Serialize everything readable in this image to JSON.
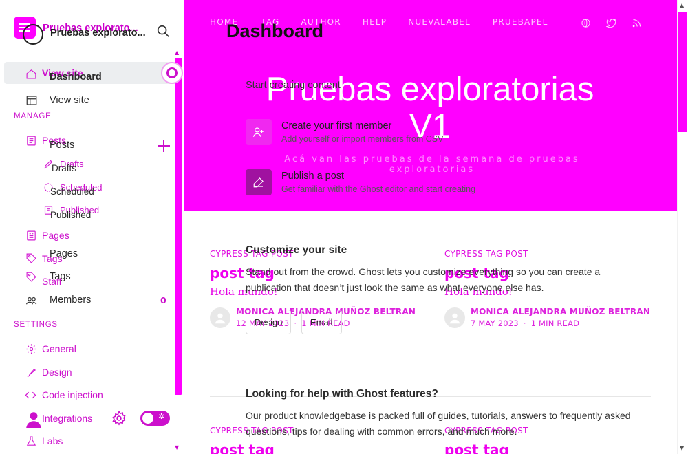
{
  "site": {
    "nav": [
      "HOME",
      "TAG",
      "AUTHOR",
      "HELP",
      "NUEVALABEL",
      "PRUEBAPEL"
    ],
    "social_icons": [
      "globe-icon",
      "twitter-icon",
      "rss-icon"
    ],
    "title": "Pruebas exploratorias V1",
    "description": "Acá van las pruebas de la semana de pruebas exploratorias",
    "posts": [
      {
        "tag": "CYPRESS TAG POST",
        "title": "post tag",
        "excerpt": "Hola mundo!",
        "author": "MONICA ALEJANDRA MUÑOZ BELTRAN",
        "date": "12 MAY 2023",
        "read": "1 MIN READ"
      },
      {
        "tag": "CYPRESS TAG POST",
        "title": "post tag",
        "excerpt": "Hola mundo!",
        "author": "MONICA ALEJANDRA MUÑOZ BELTRAN",
        "date": "7 MAY 2023",
        "read": "1 MIN READ"
      },
      {
        "tag": "CYPRESS TAG POST",
        "title": "post tag"
      },
      {
        "tag": "CYPRESS TAG POST",
        "title": "post tag"
      }
    ]
  },
  "dashboard": {
    "title": "Dashboard",
    "start_title": "Start creating content",
    "steps": [
      {
        "title": "Create your first member",
        "desc": "Add yourself or import members from CSV",
        "icon": "user-add-icon",
        "color": "#f028f0"
      },
      {
        "title": "Publish a post",
        "desc": "Get familiar with the Ghost editor and start creating",
        "icon": "edit-icon",
        "color": "#a012a0"
      }
    ],
    "customize_title": "Customize your site",
    "customize_text": "Stand out from the crowd. Ghost lets you customize everything so you can create a publication that doesn’t just look the same as what everyone else has.",
    "buttons": [
      "Design",
      "Email"
    ],
    "help_title": "Looking for help with Ghost features?",
    "help_text": "Our product knowledgebase is packed full of guides, tutorials, answers to frequently asked questions, tips for dealing with common errors, and much more."
  },
  "sidebar": {
    "site_name": "Pruebas explorato...",
    "site_name_back": "Pruebas explorato...",
    "items_front": {
      "dashboard": "Dashboard",
      "view_site": "View site",
      "posts": "Posts",
      "drafts": "Drafts",
      "scheduled": "Scheduled",
      "published": "Published",
      "pages": "Pages",
      "tags": "Tags",
      "members": "Members",
      "members_count": "0"
    },
    "items_back": {
      "view_site": "View site",
      "posts": "Posts",
      "drafts": "Drafts",
      "scheduled": "Scheduled",
      "published": "Published",
      "pages": "Pages",
      "tags": "Tags",
      "staff": "Staff"
    },
    "headings": {
      "manage": "MANAGE",
      "settings": "SETTINGS"
    },
    "settings_items": {
      "general": "General",
      "design": "Design",
      "code_injection": "Code injection",
      "integrations": "Integrations",
      "labs": "Labs"
    }
  },
  "colors": {
    "accent": "#ff00ff",
    "accent_dark": "#cc10cc"
  }
}
